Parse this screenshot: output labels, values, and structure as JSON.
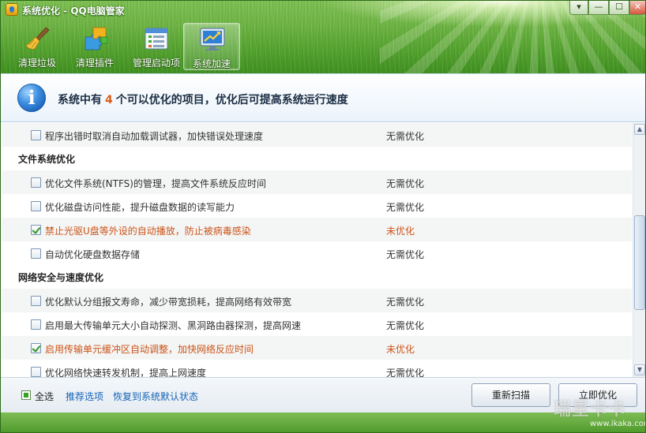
{
  "window": {
    "title": "系统优化 - QQ电脑管家",
    "controls": [
      "▾",
      "—",
      "☐",
      "✕"
    ]
  },
  "toolbar": {
    "items": [
      {
        "label": "清理垃圾",
        "icon": "broom-icon"
      },
      {
        "label": "清理插件",
        "icon": "puzzle-icon"
      },
      {
        "label": "管理启动项",
        "icon": "startup-list-icon"
      },
      {
        "label": "系统加速",
        "icon": "speedup-monitor-icon",
        "selected": true
      }
    ]
  },
  "banner": {
    "prefix": "系统中有",
    "count": "4",
    "suffix": "个可以优化的项目，优化后可提高系统运行速度"
  },
  "list": {
    "rows": [
      {
        "text": "程序出错时取消自动加载调试器，加快错误处理速度",
        "status": "无需优化",
        "checked": false
      },
      {
        "section": "文件系统优化"
      },
      {
        "text": "优化文件系统(NTFS)的管理，提高文件系统反应时间",
        "status": "无需优化",
        "checked": false
      },
      {
        "text": "优化磁盘访问性能，提升磁盘数据的读写能力",
        "status": "无需优化",
        "checked": false
      },
      {
        "text": "禁止光驱U盘等外设的自动播放，防止被病毒感染",
        "status": "未优化",
        "checked": true
      },
      {
        "text": "自动优化硬盘数据存储",
        "status": "无需优化",
        "checked": false
      },
      {
        "section": "网络安全与速度优化"
      },
      {
        "text": "优化默认分组报文寿命，减少带宽损耗，提高网络有效带宽",
        "status": "无需优化",
        "checked": false
      },
      {
        "text": "启用最大传输单元大小自动探测、黑洞路由器探测，提高网速",
        "status": "无需优化",
        "checked": false
      },
      {
        "text": "启用传输单元缓冲区自动调整，加快网络反应时间",
        "status": "未优化",
        "checked": true
      },
      {
        "text": "优化网络快速转发机制，提高上网速度",
        "status": "无需优化",
        "checked": false
      }
    ],
    "scroll_position": 0.45
  },
  "footer": {
    "select_all": "全选",
    "select_all_checked": true,
    "recommended": "推荐选项",
    "restore_default": "恢复到系统默认状态",
    "rescan": "重新扫描",
    "optimize_now": "立即优化"
  },
  "watermark": {
    "text": "瑞星卡卡",
    "url": "www.ikaka.com"
  },
  "colors": {
    "pending": "#cc5417",
    "highlight_count": "#e05a10",
    "link": "#1563b8"
  }
}
